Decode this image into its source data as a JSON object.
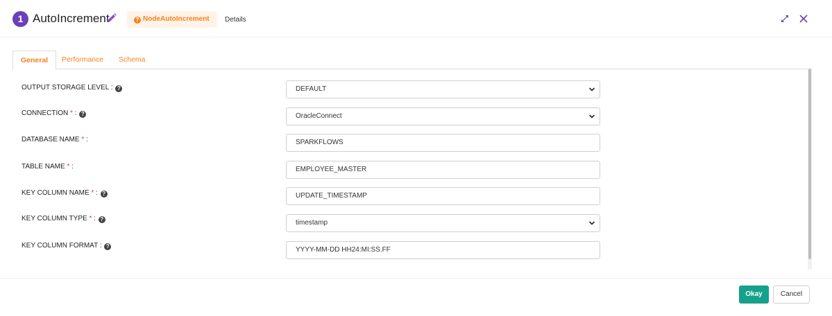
{
  "header": {
    "step_number": "1",
    "title": "AutoIncrement",
    "node_type_label": "NodeAutoIncrement",
    "details_label": "Details",
    "edit_icon": "pencil-icon",
    "expand_icon": "expand-icon",
    "close_icon": "close-icon"
  },
  "tabs": [
    {
      "label": "General",
      "active": true
    },
    {
      "label": "Performance",
      "active": false
    },
    {
      "label": "Schema",
      "active": false
    }
  ],
  "form": {
    "fields": [
      {
        "label": "OUTPUT STORAGE LEVEL",
        "required": false,
        "help": true,
        "type": "select",
        "value": "DEFAULT"
      },
      {
        "label": "CONNECTION",
        "required": true,
        "help": true,
        "type": "select",
        "value": "OracleConnect"
      },
      {
        "label": "DATABASE NAME",
        "required": true,
        "help": false,
        "type": "text",
        "value": "SPARKFLOWS"
      },
      {
        "label": "TABLE NAME",
        "required": true,
        "help": false,
        "type": "text",
        "value": "EMPLOYEE_MASTER"
      },
      {
        "label": "KEY COLUMN NAME",
        "required": true,
        "help": true,
        "type": "text",
        "value": "UPDATE_TIMESTAMP"
      },
      {
        "label": "KEY COLUMN TYPE",
        "required": true,
        "help": true,
        "type": "select",
        "value": "timestamp"
      },
      {
        "label": "KEY COLUMN FORMAT",
        "required": false,
        "help": true,
        "type": "text",
        "value": "YYYY-MM-DD HH24:MI:SS.FF"
      }
    ]
  },
  "footer": {
    "okay_label": "Okay",
    "cancel_label": "Cancel"
  },
  "colors": {
    "accent_orange": "#f58220",
    "badge_purple": "#6a41b8",
    "okay_green": "#15a18b",
    "required_red": "#e53935"
  }
}
